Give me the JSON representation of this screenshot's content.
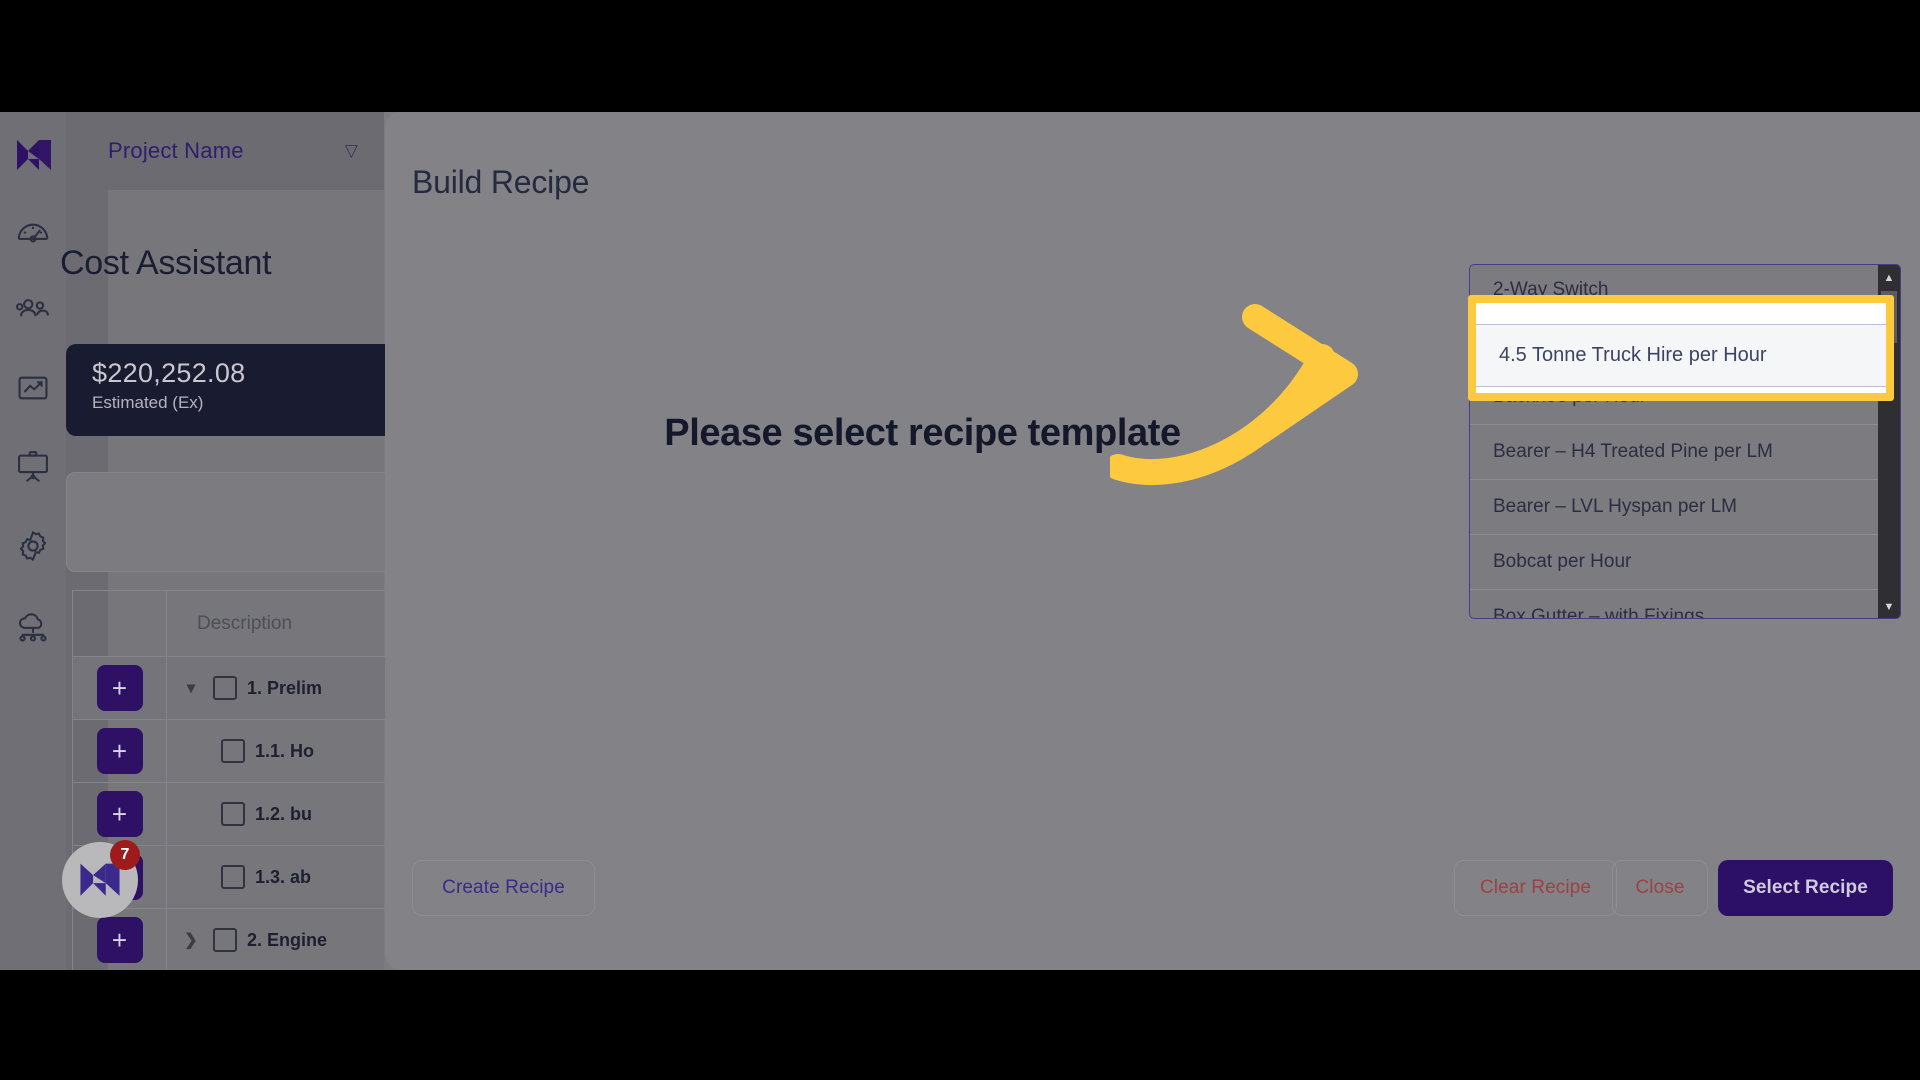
{
  "app": {
    "rail": {
      "logo_icon": "momentum-m-logo-icon",
      "items": [
        {
          "icon": "dashboard-gauge-icon",
          "name": "dashboard"
        },
        {
          "icon": "people-group-icon",
          "name": "teams"
        },
        {
          "icon": "chart-trend-icon",
          "name": "reports"
        },
        {
          "icon": "presentation-board-icon",
          "name": "presentations"
        },
        {
          "icon": "gear-settings-icon",
          "name": "settings"
        },
        {
          "icon": "cloud-network-icon",
          "name": "integrations"
        }
      ]
    },
    "sidebar": {
      "project_name": "Project Name",
      "project_caret_icon": "chevron-down-icon",
      "expand_handle_icon": "chevron-right-icon",
      "page_title": "Cost Assistant",
      "cost_card": {
        "amount": "$220,252.08",
        "label": "Estimated (Ex)"
      },
      "chat": {
        "badge_count": "7",
        "icon": "momentum-m-logo-icon"
      }
    },
    "boq": {
      "columns": [
        "",
        "Description"
      ],
      "add_label": "+",
      "rows": [
        {
          "level": 1,
          "chevron": "chevron-down-icon",
          "description": "1. Prelim"
        },
        {
          "level": 2,
          "chevron": "",
          "description": "1.1. Ho"
        },
        {
          "level": 2,
          "chevron": "",
          "description": "1.2. bu"
        },
        {
          "level": 2,
          "chevron": "",
          "description": "1.3. ab"
        },
        {
          "level": 1,
          "chevron": "chevron-right-icon",
          "description": "2. Engine"
        }
      ]
    }
  },
  "modal": {
    "title": "Build Recipe",
    "empty_state_text": "Please select recipe template",
    "buttons": {
      "create": "Create Recipe",
      "clear": "Clear Recipe",
      "close": "Close",
      "select": "Select Recipe"
    }
  },
  "dropdown": {
    "scroll_up_icon": "caret-up-icon",
    "scroll_down_icon": "caret-down-icon",
    "items": [
      {
        "label": "2-Way Switch",
        "state": "partial-top"
      },
      {
        "label": "4.5 Tonne Truck Hire per Hour",
        "state": "highlighted"
      },
      {
        "label": "Backhoe per Hour",
        "state": "normal"
      },
      {
        "label": "Bearer – H4 Treated Pine per LM",
        "state": "normal"
      },
      {
        "label": "Bearer – LVL Hyspan per LM",
        "state": "normal"
      },
      {
        "label": "Bobcat per Hour",
        "state": "normal"
      },
      {
        "label": "Box Gutter – with Fixings",
        "state": "partial-bottom"
      }
    ],
    "selected": "4.5 Tonne Truck Hire per Hour"
  },
  "annotation": {
    "arrow_icon": "curved-arrow-right-icon",
    "highlight_color": "#fcc93f",
    "target_label": "4.5 Tonne Truck Hire per Hour"
  },
  "colors": {
    "brand_violet": "#2e1065",
    "accent_yellow": "#fcc93f",
    "danger_red": "#9c4242",
    "card_dark": "#191c30",
    "overlay_scrim": "#7d7d80"
  }
}
